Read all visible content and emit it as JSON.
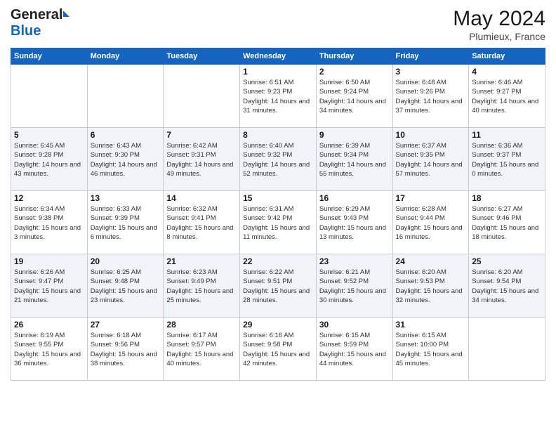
{
  "header": {
    "logo_general": "General",
    "logo_blue": "Blue",
    "month_year": "May 2024",
    "location": "Plumieux, France"
  },
  "days_of_week": [
    "Sunday",
    "Monday",
    "Tuesday",
    "Wednesday",
    "Thursday",
    "Friday",
    "Saturday"
  ],
  "weeks": [
    [
      {
        "day": "",
        "sunrise": "",
        "sunset": "",
        "daylight": ""
      },
      {
        "day": "",
        "sunrise": "",
        "sunset": "",
        "daylight": ""
      },
      {
        "day": "",
        "sunrise": "",
        "sunset": "",
        "daylight": ""
      },
      {
        "day": "1",
        "sunrise": "Sunrise: 6:51 AM",
        "sunset": "Sunset: 9:23 PM",
        "daylight": "Daylight: 14 hours and 31 minutes."
      },
      {
        "day": "2",
        "sunrise": "Sunrise: 6:50 AM",
        "sunset": "Sunset: 9:24 PM",
        "daylight": "Daylight: 14 hours and 34 minutes."
      },
      {
        "day": "3",
        "sunrise": "Sunrise: 6:48 AM",
        "sunset": "Sunset: 9:26 PM",
        "daylight": "Daylight: 14 hours and 37 minutes."
      },
      {
        "day": "4",
        "sunrise": "Sunrise: 6:46 AM",
        "sunset": "Sunset: 9:27 PM",
        "daylight": "Daylight: 14 hours and 40 minutes."
      }
    ],
    [
      {
        "day": "5",
        "sunrise": "Sunrise: 6:45 AM",
        "sunset": "Sunset: 9:28 PM",
        "daylight": "Daylight: 14 hours and 43 minutes."
      },
      {
        "day": "6",
        "sunrise": "Sunrise: 6:43 AM",
        "sunset": "Sunset: 9:30 PM",
        "daylight": "Daylight: 14 hours and 46 minutes."
      },
      {
        "day": "7",
        "sunrise": "Sunrise: 6:42 AM",
        "sunset": "Sunset: 9:31 PM",
        "daylight": "Daylight: 14 hours and 49 minutes."
      },
      {
        "day": "8",
        "sunrise": "Sunrise: 6:40 AM",
        "sunset": "Sunset: 9:32 PM",
        "daylight": "Daylight: 14 hours and 52 minutes."
      },
      {
        "day": "9",
        "sunrise": "Sunrise: 6:39 AM",
        "sunset": "Sunset: 9:34 PM",
        "daylight": "Daylight: 14 hours and 55 minutes."
      },
      {
        "day": "10",
        "sunrise": "Sunrise: 6:37 AM",
        "sunset": "Sunset: 9:35 PM",
        "daylight": "Daylight: 14 hours and 57 minutes."
      },
      {
        "day": "11",
        "sunrise": "Sunrise: 6:36 AM",
        "sunset": "Sunset: 9:37 PM",
        "daylight": "Daylight: 15 hours and 0 minutes."
      }
    ],
    [
      {
        "day": "12",
        "sunrise": "Sunrise: 6:34 AM",
        "sunset": "Sunset: 9:38 PM",
        "daylight": "Daylight: 15 hours and 3 minutes."
      },
      {
        "day": "13",
        "sunrise": "Sunrise: 6:33 AM",
        "sunset": "Sunset: 9:39 PM",
        "daylight": "Daylight: 15 hours and 6 minutes."
      },
      {
        "day": "14",
        "sunrise": "Sunrise: 6:32 AM",
        "sunset": "Sunset: 9:41 PM",
        "daylight": "Daylight: 15 hours and 8 minutes."
      },
      {
        "day": "15",
        "sunrise": "Sunrise: 6:31 AM",
        "sunset": "Sunset: 9:42 PM",
        "daylight": "Daylight: 15 hours and 11 minutes."
      },
      {
        "day": "16",
        "sunrise": "Sunrise: 6:29 AM",
        "sunset": "Sunset: 9:43 PM",
        "daylight": "Daylight: 15 hours and 13 minutes."
      },
      {
        "day": "17",
        "sunrise": "Sunrise: 6:28 AM",
        "sunset": "Sunset: 9:44 PM",
        "daylight": "Daylight: 15 hours and 16 minutes."
      },
      {
        "day": "18",
        "sunrise": "Sunrise: 6:27 AM",
        "sunset": "Sunset: 9:46 PM",
        "daylight": "Daylight: 15 hours and 18 minutes."
      }
    ],
    [
      {
        "day": "19",
        "sunrise": "Sunrise: 6:26 AM",
        "sunset": "Sunset: 9:47 PM",
        "daylight": "Daylight: 15 hours and 21 minutes."
      },
      {
        "day": "20",
        "sunrise": "Sunrise: 6:25 AM",
        "sunset": "Sunset: 9:48 PM",
        "daylight": "Daylight: 15 hours and 23 minutes."
      },
      {
        "day": "21",
        "sunrise": "Sunrise: 6:23 AM",
        "sunset": "Sunset: 9:49 PM",
        "daylight": "Daylight: 15 hours and 25 minutes."
      },
      {
        "day": "22",
        "sunrise": "Sunrise: 6:22 AM",
        "sunset": "Sunset: 9:51 PM",
        "daylight": "Daylight: 15 hours and 28 minutes."
      },
      {
        "day": "23",
        "sunrise": "Sunrise: 6:21 AM",
        "sunset": "Sunset: 9:52 PM",
        "daylight": "Daylight: 15 hours and 30 minutes."
      },
      {
        "day": "24",
        "sunrise": "Sunrise: 6:20 AM",
        "sunset": "Sunset: 9:53 PM",
        "daylight": "Daylight: 15 hours and 32 minutes."
      },
      {
        "day": "25",
        "sunrise": "Sunrise: 6:20 AM",
        "sunset": "Sunset: 9:54 PM",
        "daylight": "Daylight: 15 hours and 34 minutes."
      }
    ],
    [
      {
        "day": "26",
        "sunrise": "Sunrise: 6:19 AM",
        "sunset": "Sunset: 9:55 PM",
        "daylight": "Daylight: 15 hours and 36 minutes."
      },
      {
        "day": "27",
        "sunrise": "Sunrise: 6:18 AM",
        "sunset": "Sunset: 9:56 PM",
        "daylight": "Daylight: 15 hours and 38 minutes."
      },
      {
        "day": "28",
        "sunrise": "Sunrise: 6:17 AM",
        "sunset": "Sunset: 9:57 PM",
        "daylight": "Daylight: 15 hours and 40 minutes."
      },
      {
        "day": "29",
        "sunrise": "Sunrise: 6:16 AM",
        "sunset": "Sunset: 9:58 PM",
        "daylight": "Daylight: 15 hours and 42 minutes."
      },
      {
        "day": "30",
        "sunrise": "Sunrise: 6:15 AM",
        "sunset": "Sunset: 9:59 PM",
        "daylight": "Daylight: 15 hours and 44 minutes."
      },
      {
        "day": "31",
        "sunrise": "Sunrise: 6:15 AM",
        "sunset": "Sunset: 10:00 PM",
        "daylight": "Daylight: 15 hours and 45 minutes."
      },
      {
        "day": "",
        "sunrise": "",
        "sunset": "",
        "daylight": ""
      }
    ]
  ]
}
